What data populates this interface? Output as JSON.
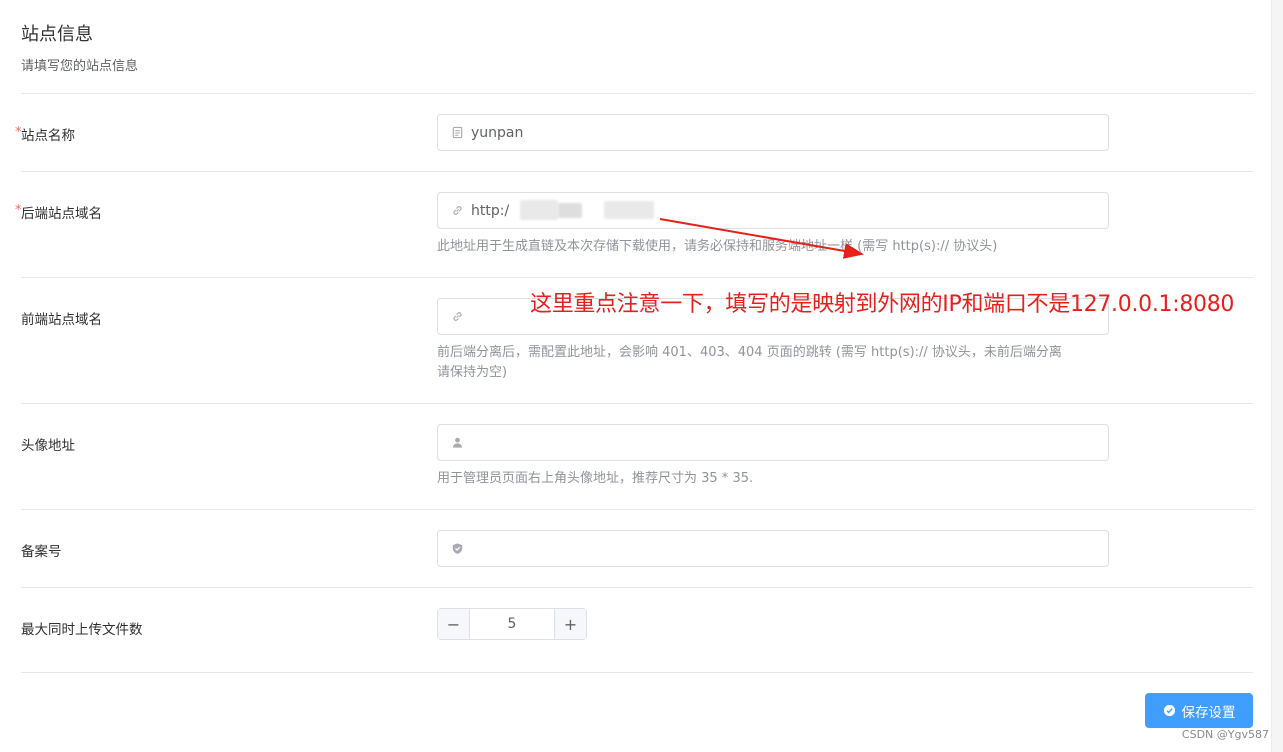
{
  "header": {
    "title": "站点信息",
    "subtitle": "请填写您的站点信息"
  },
  "fields": {
    "site_name": {
      "label": "站点名称",
      "required_mark": "*",
      "value": "yunpan",
      "icon": "document-icon"
    },
    "backend_domain": {
      "label": "后端站点域名",
      "required_mark": "*",
      "value": "http:/",
      "icon": "link-icon",
      "help": "此地址用于生成直链及本次存储下载使用，请务必保持和服务端地址一样 (需写 http(s):// 协议头)"
    },
    "frontend_domain": {
      "label": "前端站点域名",
      "value": "",
      "icon": "link-icon",
      "help_line1": "前后端分离后，需配置此地址，会影响 401、403、404 页面的跳转 (需写 http(s):// 协议头，未前后端分离",
      "help_line2": "请保持为空)"
    },
    "avatar_url": {
      "label": "头像地址",
      "value": "",
      "icon": "user-icon",
      "help": "用于管理员页面右上角头像地址，推荐尺寸为 35 * 35."
    },
    "icp_number": {
      "label": "备案号",
      "value": "",
      "icon": "shield-icon"
    },
    "max_uploads": {
      "label": "最大同时上传文件数",
      "value": "5",
      "minus": "−",
      "plus": "+"
    }
  },
  "actions": {
    "save_label": "保存设置"
  },
  "annotation": {
    "text": "这里重点注意一下，填写的是映射到外网的IP和端口不是127.0.0.1:8080",
    "color": "#e8201c"
  },
  "watermark": "CSDN @Ygv587",
  "colors": {
    "primary": "#409eff",
    "required": "#f56c6c",
    "border": "#dcdfe6"
  }
}
